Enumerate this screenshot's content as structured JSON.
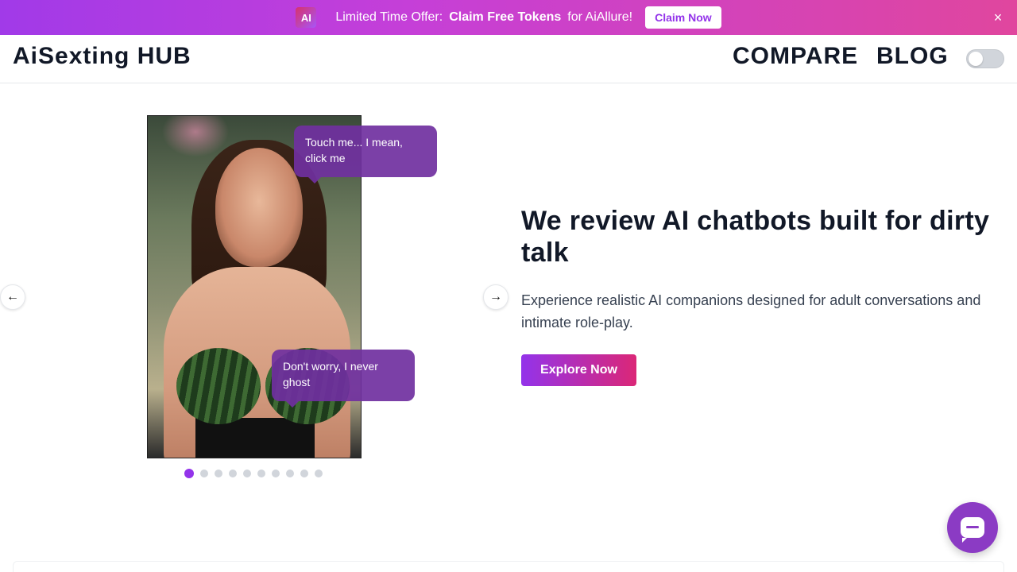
{
  "promo": {
    "logo_text": "AI",
    "lead": "Limited Time Offer:",
    "strong": "Claim Free Tokens",
    "tail": "for AiAllure!",
    "button": "Claim Now",
    "close": "×",
    "colors": {
      "start": "#a13ae8",
      "end": "#e0469e"
    }
  },
  "header": {
    "brand": "AiSexting HUB",
    "nav": [
      "COMPARE",
      "BLOG"
    ],
    "theme_toggle": "off"
  },
  "carousel": {
    "bubbles": [
      "Touch me... I mean, click me",
      "Don't worry, I never ghost"
    ],
    "prev_icon": "←",
    "next_icon": "→",
    "total_slides": 10,
    "active_slide": 1
  },
  "hero": {
    "title": "We review AI chatbots built for dirty talk",
    "description": "Experience realistic AI companions designed for adult conversations and intimate role-play.",
    "cta": "Explore Now",
    "accent": "#9333ea"
  },
  "chat_widget": {
    "icon": "chat-bubble-icon"
  }
}
